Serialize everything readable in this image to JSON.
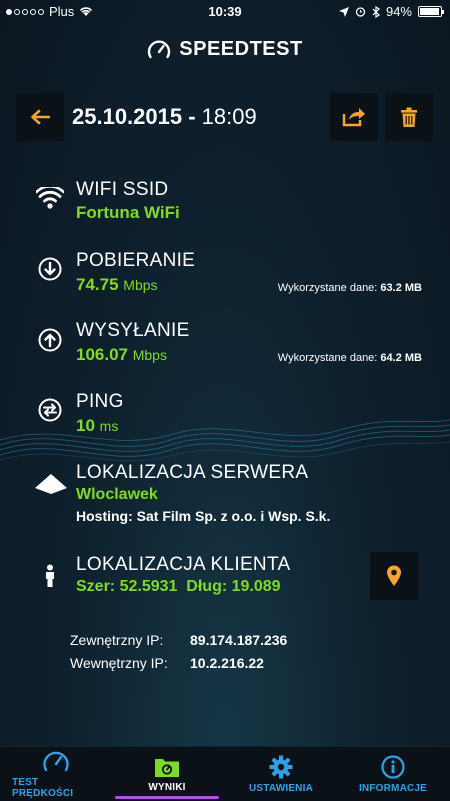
{
  "status_bar": {
    "carrier": "Plus",
    "time": "10:39",
    "battery": "94%"
  },
  "app": {
    "name": "SPEEDTEST"
  },
  "header": {
    "date": "25.10.2015",
    "separator": " - ",
    "time": "18:09"
  },
  "wifi": {
    "label": "WIFI SSID",
    "value": "Fortuna WiFi"
  },
  "download": {
    "label": "POBIERANIE",
    "value": "74.75",
    "unit": "Mbps",
    "used_label": "Wykorzystane dane:",
    "used_value": "63.2 MB"
  },
  "upload": {
    "label": "WYSYŁANIE",
    "value": "106.07",
    "unit": "Mbps",
    "used_label": "Wykorzystane dane:",
    "used_value": "64.2 MB"
  },
  "ping": {
    "label": "PING",
    "value": "10",
    "unit": "ms"
  },
  "server": {
    "label": "LOKALIZACJA SERWERA",
    "city": "Wloclawek",
    "hosting": "Hosting: Sat Film Sp. z o.o. i Wsp. S.k."
  },
  "client": {
    "label": "LOKALIZACJA KLIENTA",
    "lat": "Szer: 52.5931",
    "lon": "Dług: 19.089"
  },
  "ips": {
    "external_label": "Zewnętrzny IP:",
    "external_value": "89.174.187.236",
    "internal_label": "Wewnętrzny IP:",
    "internal_value": "10.2.216.22"
  },
  "tabs": [
    {
      "label": "TEST PRĘDKOŚCI",
      "icon": "speedometer-icon"
    },
    {
      "label": "WYNIKI",
      "icon": "results-folder-icon"
    },
    {
      "label": "USTAWIENIA",
      "icon": "gear-icon"
    },
    {
      "label": "INFORMACJE",
      "icon": "info-icon"
    }
  ],
  "colors": {
    "accent_green": "#7fdc1c",
    "accent_orange": "#f5a623",
    "tab_blue": "#2aa4e8",
    "active_underline": "#b24ee8"
  }
}
